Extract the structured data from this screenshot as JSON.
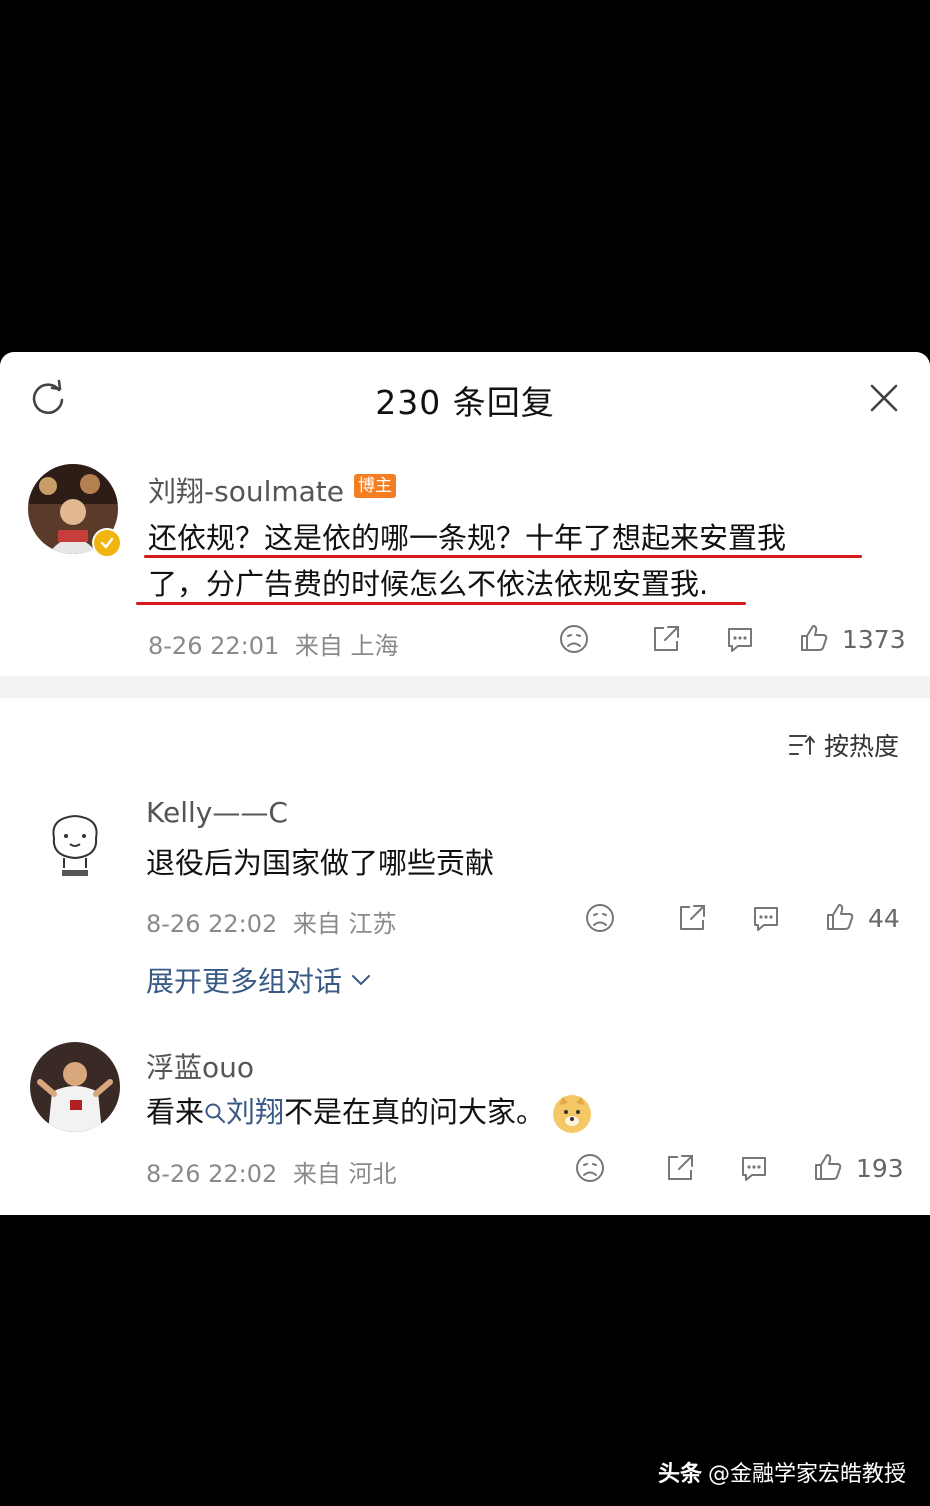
{
  "header": {
    "title": "230 条回复",
    "refresh_icon": "refresh-icon",
    "close_icon": "close-icon"
  },
  "main_comment": {
    "username": "刘翔-soulmate",
    "badge": "博主",
    "text_line1": "还依规？这是依的哪一条规？十年了想起来安置我",
    "text_line2": "了，分广告费的时候怎么不依法依规安置我.",
    "time": "8-26 22:01",
    "location": "来自 上海",
    "likes": "1373",
    "underline_color": "#d41a1a"
  },
  "sort": {
    "label": "按热度"
  },
  "replies": [
    {
      "username": "Kelly——C",
      "text": "退役后为国家做了哪些贡献",
      "time": "8-26 22:02",
      "location": "来自 江苏",
      "likes": "44"
    },
    {
      "username": "浮蓝ouo",
      "text_prefix": "看来",
      "mention": "刘翔",
      "text_suffix": "不是在真的问大家。",
      "time": "8-26 22:02",
      "location": "来自 河北",
      "likes": "193"
    }
  ],
  "expand": {
    "label": "展开更多组对话"
  },
  "watermark": {
    "brand": "头条",
    "handle": "@金融学家宏皓教授"
  },
  "colors": {
    "link": "#3a5a86",
    "badge": "#f57e22",
    "verified": "#f2b50f"
  }
}
